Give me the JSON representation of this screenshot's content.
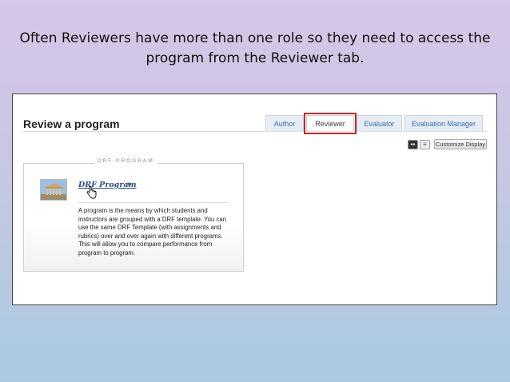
{
  "caption": {
    "line1": "Often Reviewers have more than one role so they need to access the",
    "line2": "program from the Reviewer tab."
  },
  "page": {
    "title": "Review a program"
  },
  "tabs": [
    {
      "label": "Author",
      "active": false
    },
    {
      "label": "Reviewer",
      "active": true
    },
    {
      "label": "Evaluator",
      "active": false
    },
    {
      "label": "Evaluation Manager",
      "active": false
    }
  ],
  "toolbar": {
    "grid_view_icon": "grid-icon",
    "list_view_icon": "list-icon",
    "customize_label": "Customize Display"
  },
  "card": {
    "label": "DRF PROGRAM",
    "link_text": "DRF Program",
    "arrow": "»",
    "description": "A program is the means by which students and instructors are grouped with a DRF template. You can use the same DRF Template (with assignments and rubrics) over and over again with different programs. This will allow you to compare performance from program to program."
  },
  "colors": {
    "highlight": "#c62828",
    "tab_link": "#3a6fa6",
    "program_link": "#2b4c88"
  }
}
